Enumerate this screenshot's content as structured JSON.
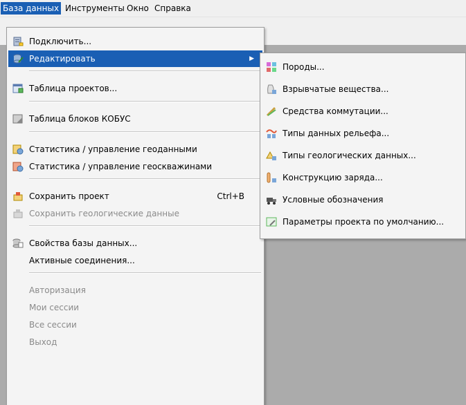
{
  "menubar": {
    "items": [
      "База данных",
      "Инструменты",
      "Окно",
      "Справка"
    ]
  },
  "main_menu": {
    "connect": "Подключить...",
    "edit": "Редактировать",
    "projects_table": "Таблица проектов...",
    "kobus_table": "Таблица блоков КОБУС",
    "stats_geodata": "Статистика / управление геоданными",
    "stats_wells": "Статистика / управление геоскважинами",
    "save_project": "Сохранить проект",
    "save_project_shortcut": "Ctrl+B",
    "save_geo": "Сохранить геологические данные",
    "db_properties": "Свойства базы данных...",
    "active_connections": "Активные соединения...",
    "authorization": "Авторизация",
    "my_sessions": "Мои сессии",
    "all_sessions": "Все сессии",
    "exit": "Выход"
  },
  "sub_menu": {
    "rocks": "Породы...",
    "explosives": "Взрывчатые вещества...",
    "switching": "Средства коммутации...",
    "relief_types": "Типы данных рельефа...",
    "geo_types": "Типы геологических данных...",
    "charge_design": "Конструкцию заряда...",
    "legend": "Условные обозначения",
    "defaults": "Параметры проекта по умолчанию..."
  },
  "colors": {
    "highlight": "#1a5fb4",
    "disabled_text": "#8a8a8a",
    "workspace": "#ababab"
  }
}
